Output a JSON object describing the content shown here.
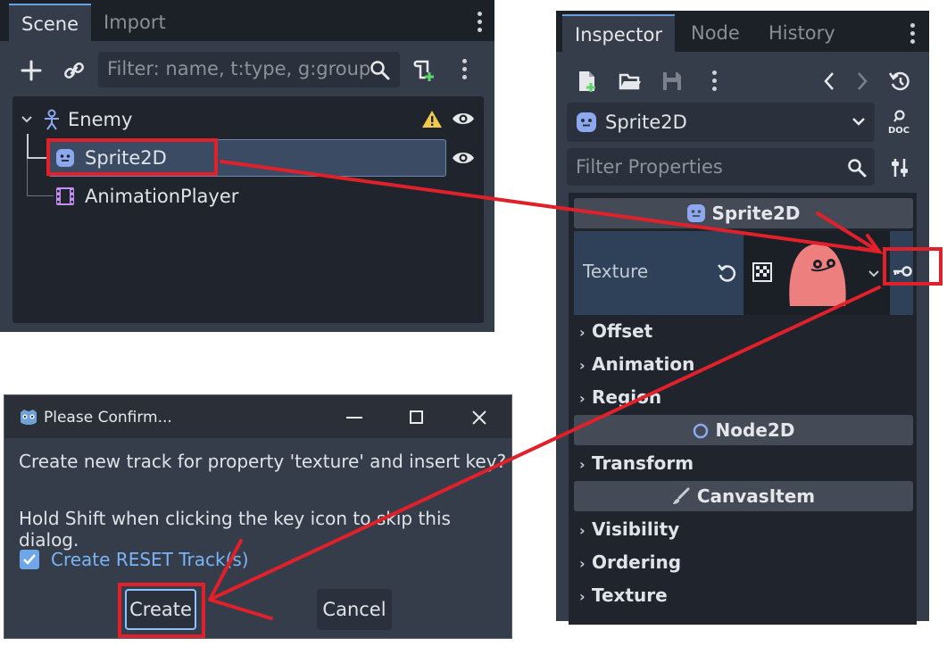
{
  "scene_panel": {
    "tabs": [
      "Scene",
      "Import"
    ],
    "filter_placeholder": "Filter: name, t:type, g:group",
    "tree": [
      {
        "label": "Enemy",
        "icon": "character-body-icon",
        "warning": true,
        "visible": true
      },
      {
        "label": "Sprite2D",
        "icon": "sprite2d-icon",
        "selected": true,
        "visible": true
      },
      {
        "label": "AnimationPlayer",
        "icon": "animation-player-icon"
      }
    ]
  },
  "inspector": {
    "tabs": [
      "Inspector",
      "Node",
      "History"
    ],
    "object_name": "Sprite2D",
    "filter_placeholder": "Filter Properties",
    "sections": {
      "sprite2d": "Sprite2D",
      "node2d": "Node2D",
      "canvasitem": "CanvasItem"
    },
    "texture_label": "Texture",
    "sprite_groups": [
      "Offset",
      "Animation",
      "Region"
    ],
    "node2d_groups": [
      "Transform"
    ],
    "canvas_groups": [
      "Visibility",
      "Ordering",
      "Texture"
    ]
  },
  "dialog": {
    "title": "Please Confirm...",
    "message": "Create new track for property 'texture' and insert key?",
    "hint": "Hold Shift when clicking the key icon to skip this dialog.",
    "checkbox_label": "Create RESET Track(s)",
    "checkbox_checked": true,
    "create_label": "Create",
    "cancel_label": "Cancel"
  },
  "colors": {
    "annotation_red": "#e0202a",
    "accent_blue": "#6b9fe0",
    "panel_bg": "#363d4a",
    "tree_bg": "#20252d",
    "selection_bg": "#3b4b63"
  }
}
